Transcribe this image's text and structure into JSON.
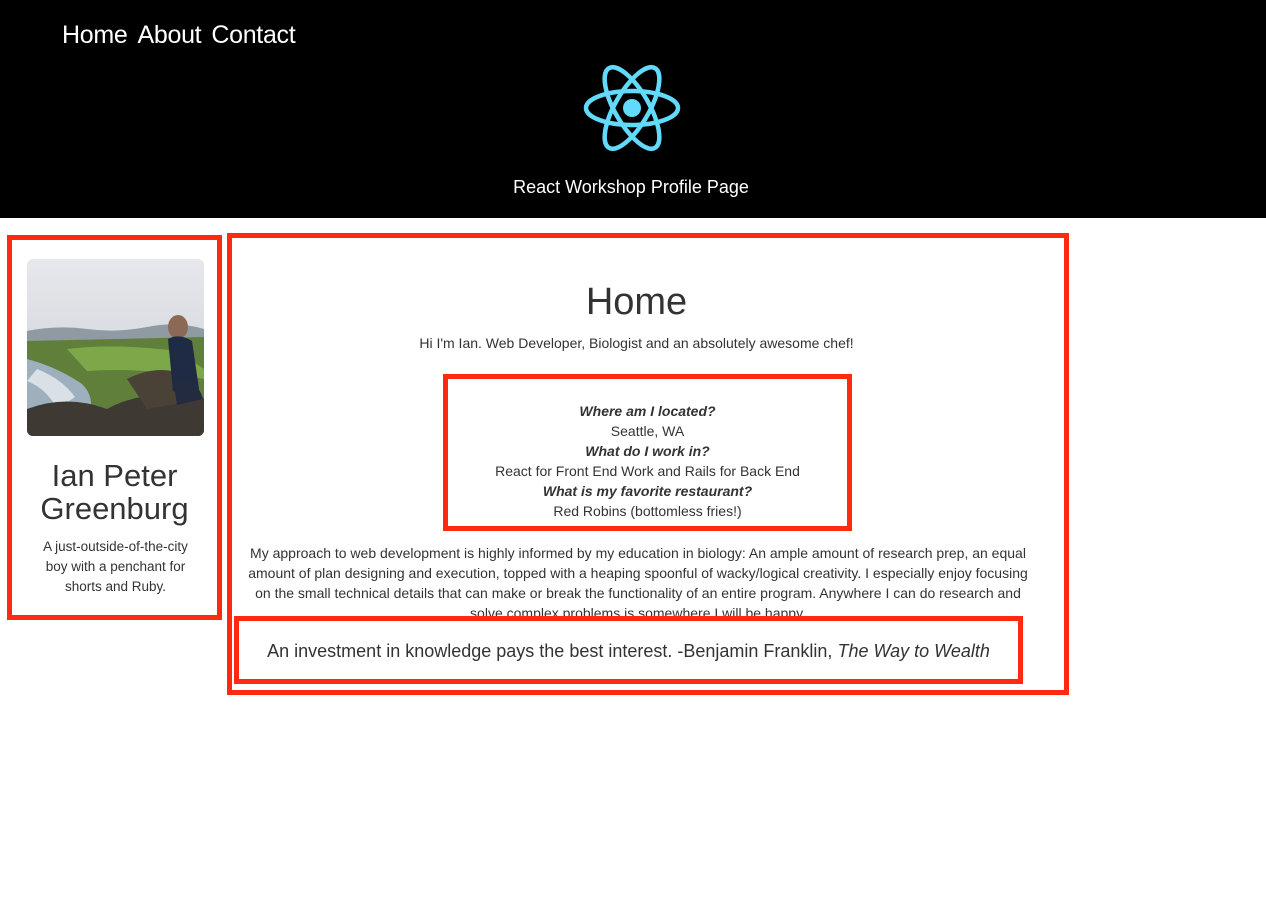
{
  "nav": {
    "items": [
      "Home",
      "About",
      "Contact"
    ]
  },
  "header": {
    "logo_icon": "react-atom-icon",
    "title": "React Workshop Profile Page",
    "logo_color": "#61dafb"
  },
  "profile": {
    "photo_alt": "profile-photo",
    "name": "Ian Peter Greenburg",
    "bio": "A just-outside-of-the-city boy with a penchant for shorts and Ruby."
  },
  "main": {
    "title": "Home",
    "intro": "Hi I'm Ian. Web Developer, Biologist and an absolutely awesome chef!",
    "facts": [
      {
        "question": "Where am I located?",
        "answer": "Seattle, WA"
      },
      {
        "question": "What do I work in?",
        "answer": "React for Front End Work and Rails for Back End"
      },
      {
        "question": "What is my favorite restaurant?",
        "answer": "Red Robins (bottomless fries!)"
      }
    ],
    "approach": "My approach to web development is highly informed by my education in biology: An ample amount of research prep, an equal amount of plan designing and execution, topped with a heaping spoonful of wacky/logical creativity. I especially enjoy focusing on the small technical details that can make or break the functionality of an entire program. Anywhere I can do research and solve complex problems is somewhere I will be happy.",
    "quote": {
      "text": "An investment in knowledge pays the best interest. -Benjamin Franklin,",
      "source": "The Way to Wealth"
    }
  },
  "colors": {
    "header_bg": "#000000",
    "highlight_border": "#ff2a0f",
    "text": "#333333"
  }
}
